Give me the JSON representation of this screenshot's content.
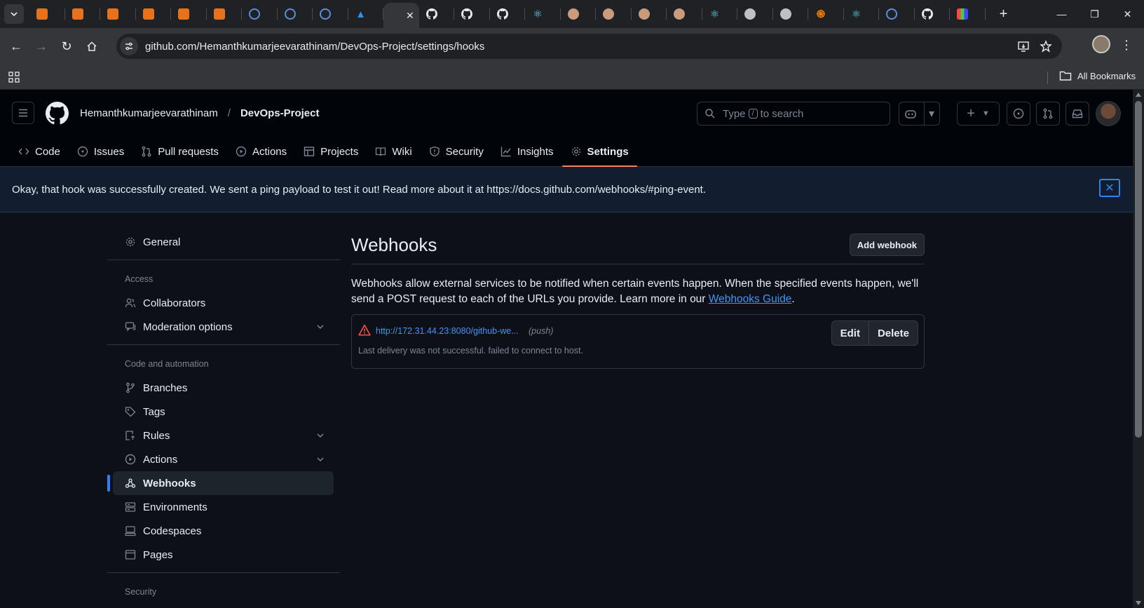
{
  "browser": {
    "tabs": [
      {
        "icon": "orange-square-icon"
      },
      {
        "icon": "orange-square-icon"
      },
      {
        "icon": "orange-square-icon"
      },
      {
        "icon": "orange-square-icon"
      },
      {
        "icon": "orange-square-icon"
      },
      {
        "icon": "orange-square-icon"
      },
      {
        "icon": "blue-circle-icon"
      },
      {
        "icon": "blue-circle-icon"
      },
      {
        "icon": "blue-circle-icon"
      },
      {
        "icon": "docker-icon"
      },
      {
        "icon": "active-tab",
        "active": true
      },
      {
        "icon": "github-icon"
      },
      {
        "icon": "github-icon"
      },
      {
        "icon": "github-icon"
      },
      {
        "icon": "react-icon"
      },
      {
        "icon": "face-icon"
      },
      {
        "icon": "face-icon"
      },
      {
        "icon": "face-icon"
      },
      {
        "icon": "face-icon"
      },
      {
        "icon": "react-icon"
      },
      {
        "icon": "globe-icon"
      },
      {
        "icon": "globe-icon"
      },
      {
        "icon": "spiral-icon"
      },
      {
        "icon": "react-icon"
      },
      {
        "icon": "blue-circle-icon"
      },
      {
        "icon": "github-icon"
      },
      {
        "icon": "colors-icon"
      }
    ],
    "url": "github.com/Hemanthkumarjeevarathinam/DevOps-Project/settings/hooks",
    "bookmarks_label": "All Bookmarks"
  },
  "header": {
    "owner": "Hemanthkumarjeevarathinam",
    "separator": "/",
    "repo": "DevOps-Project",
    "search_prefix": "Type",
    "search_key": "/",
    "search_suffix": "to search"
  },
  "repo_nav": [
    {
      "label": "Code",
      "icon": "code-icon"
    },
    {
      "label": "Issues",
      "icon": "issue-icon"
    },
    {
      "label": "Pull requests",
      "icon": "pull-request-icon"
    },
    {
      "label": "Actions",
      "icon": "play-icon"
    },
    {
      "label": "Projects",
      "icon": "table-icon"
    },
    {
      "label": "Wiki",
      "icon": "book-icon"
    },
    {
      "label": "Security",
      "icon": "shield-icon"
    },
    {
      "label": "Insights",
      "icon": "graph-icon"
    },
    {
      "label": "Settings",
      "icon": "gear-icon",
      "selected": true
    }
  ],
  "flash": {
    "message": "Okay, that hook was successfully created. We sent a ping payload to test it out! Read more about it at https://docs.github.com/webhooks/#ping-event."
  },
  "sidebar": {
    "general": "General",
    "access_heading": "Access",
    "access_items": [
      {
        "label": "Collaborators",
        "icon": "people-icon"
      },
      {
        "label": "Moderation options",
        "icon": "comment-icon",
        "expandable": true
      }
    ],
    "code_heading": "Code and automation",
    "code_items": [
      {
        "label": "Branches",
        "icon": "branch-icon"
      },
      {
        "label": "Tags",
        "icon": "tag-icon"
      },
      {
        "label": "Rules",
        "icon": "rules-icon",
        "expandable": true
      },
      {
        "label": "Actions",
        "icon": "play-icon",
        "expandable": true
      },
      {
        "label": "Webhooks",
        "icon": "webhook-icon",
        "selected": true
      },
      {
        "label": "Environments",
        "icon": "server-icon"
      },
      {
        "label": "Codespaces",
        "icon": "codespaces-icon"
      },
      {
        "label": "Pages",
        "icon": "browser-icon"
      }
    ],
    "security_heading": "Security"
  },
  "main": {
    "title": "Webhooks",
    "add_button": "Add webhook",
    "description": "Webhooks allow external services to be notified when certain events happen. When the specified events happen, we'll send a POST request to each of the URLs you provide. Learn more in our",
    "guide_link": "Webhooks Guide",
    "period": ".",
    "hook": {
      "url": "http://172.31.44.23:8080/github-we...",
      "events": "(push)",
      "status": "Last delivery was not successful. failed to connect to host.",
      "edit": "Edit",
      "delete": "Delete"
    }
  },
  "colors": {
    "accent": "#2f81f7",
    "link": "#4493f8",
    "tab_underline": "#f78166",
    "warning": "#f85149"
  }
}
